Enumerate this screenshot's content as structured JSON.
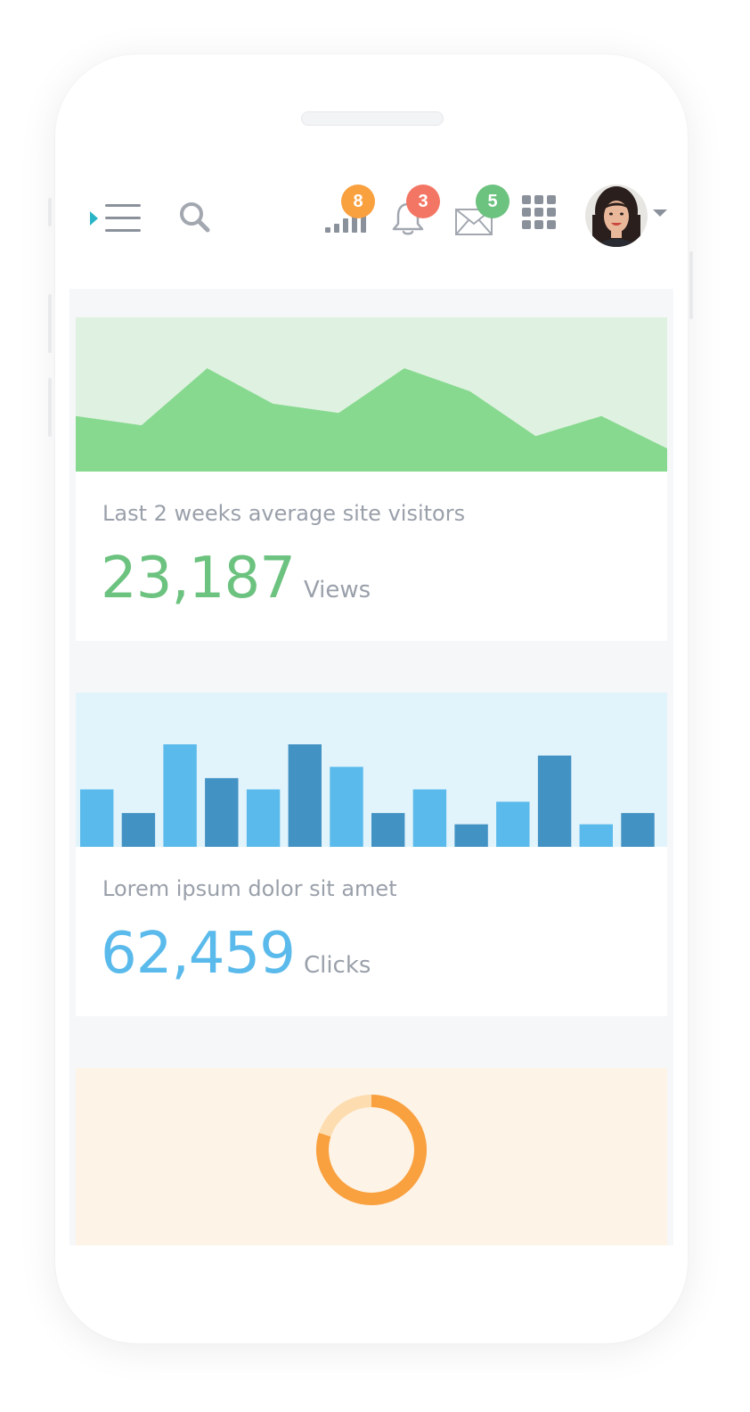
{
  "colors": {
    "green": "#6cc27f",
    "green_fill": "#86d98f",
    "green_bg": "#dff1e0",
    "blue": "#5abaeb",
    "blue_dark": "#4392c4",
    "blue_bg": "#e1f3fb",
    "orange": "#f9a03f",
    "orange_light": "#fddcb0",
    "orange_bg": "#fdf3e6",
    "badge_orange": "#f9a03f",
    "badge_red": "#f37664",
    "badge_green": "#6cc27f",
    "icon_gray": "#9aa0aa"
  },
  "topbar": {
    "menu_icon": "hamburger-icon",
    "search_icon": "search-icon",
    "stats_icon": "signal-bars-icon",
    "stats_badge": "8",
    "notifications_icon": "bell-icon",
    "notifications_badge": "3",
    "messages_icon": "envelope-icon",
    "messages_badge": "5",
    "apps_icon": "grid-icon",
    "avatar": "user-avatar",
    "dropdown_icon": "caret-down-icon"
  },
  "cards": [
    {
      "label": "Last 2 weeks average site visitors",
      "value": "23,187",
      "unit": "Views",
      "chart": {
        "type": "area",
        "values": [
          0.36,
          0.3,
          0.67,
          0.44,
          0.38,
          0.67,
          0.52,
          0.23,
          0.36,
          0.15
        ]
      }
    },
    {
      "label": "Lorem ipsum dolor sit amet",
      "value": "62,459",
      "unit": "Clicks",
      "chart": {
        "type": "bar",
        "values": [
          0.56,
          0.33,
          1.0,
          0.67,
          0.56,
          1.0,
          0.78,
          0.33,
          0.56,
          0.22,
          0.44,
          0.89,
          0.22,
          0.33
        ],
        "dark_bars": [
          1,
          3,
          5,
          7,
          9,
          11,
          13
        ]
      }
    },
    {
      "chart": {
        "type": "donut",
        "value": 0.8
      }
    }
  ]
}
